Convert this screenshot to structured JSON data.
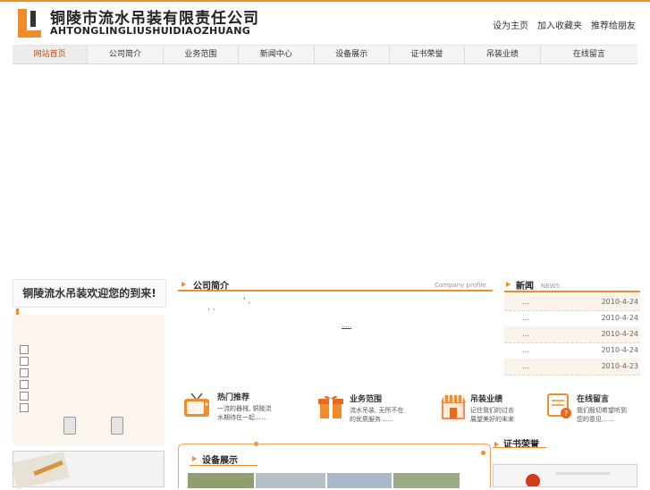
{
  "header": {
    "brand_cn": "铜陵市流水吊装有限责任公司",
    "brand_en": "AHTONGLINGLIUSHUIDIAOZHUANG",
    "links": [
      "设为主页",
      "加入收藏夹",
      "推荐给朋友"
    ]
  },
  "nav": {
    "items": [
      "网站首页",
      "公司简介",
      "业务范围",
      "新闻中心",
      "设备展示",
      "证书荣誉",
      "吊装业绩",
      "在线留言"
    ]
  },
  "welcome": "铜陵流水吊装欢迎您的到来!",
  "profile": {
    "title": "公司简介",
    "subtitle": "Company profile",
    "body": "' .",
    "body2": "· ·",
    "more": "....."
  },
  "news": {
    "title": "新闻",
    "subtitle": "NEWS",
    "items": [
      {
        "title": "...",
        "date": "2010-4-24"
      },
      {
        "title": "...",
        "date": "2010-4-24"
      },
      {
        "title": "...",
        "date": "2010-4-24"
      },
      {
        "title": "...",
        "date": "2010-4-24"
      },
      {
        "title": "...",
        "date": "2010-4-23"
      }
    ]
  },
  "features": [
    {
      "title": "热门推荐",
      "line1": "一流的器械, 铜陵流",
      "line2": "水期待在一起……",
      "icon": "tv-icon"
    },
    {
      "title": "业务范围",
      "line1": "流水吊装, 无所不在",
      "line2": "的优质服务……",
      "icon": "gift-box-icon"
    },
    {
      "title": "吊装业绩",
      "line1": "记住我们的过去",
      "line2": "展望美好的未来",
      "icon": "shop-icon"
    },
    {
      "title": "在线留言",
      "line1": "我们殷切希望听到",
      "line2": "您的意见……",
      "icon": "message-icon"
    }
  ],
  "equipment": {
    "title": "设备展示"
  },
  "certificates": {
    "title": "证书荣誉"
  },
  "colors": {
    "accent": "#f08c2a",
    "nav_active": "#c34a0a",
    "light_bg": "#fbf5ee"
  }
}
